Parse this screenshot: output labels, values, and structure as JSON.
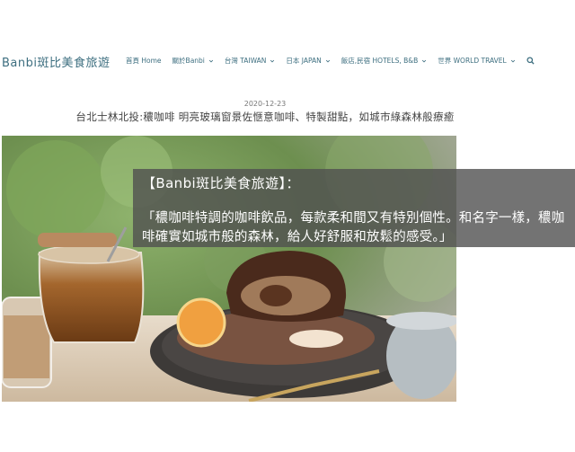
{
  "header": {
    "site_title": "Banbi斑比美食旅遊",
    "nav": [
      {
        "label": "首頁 Home",
        "has_dropdown": false
      },
      {
        "label": "關於Banbi",
        "has_dropdown": true
      },
      {
        "label": "台灣 TAIWAN",
        "has_dropdown": true
      },
      {
        "label": "日本 JAPAN",
        "has_dropdown": true
      },
      {
        "label": "飯店,民宿 HOTELS, B&B",
        "has_dropdown": true
      },
      {
        "label": "世界 WORLD TRAVEL",
        "has_dropdown": true
      }
    ],
    "search_icon": "search-icon"
  },
  "post": {
    "date": "2020-12-23",
    "title": "台北士林北投:穠咖啡 明亮玻璃窗景佐愜意咖啡、特製甜點，如城市綠森林般療癒"
  },
  "hero": {
    "caption_head": "【Banbi斑比美食旅遊】：",
    "caption_body": "「穠咖啡特調的咖啡飲品，每款柔和間又有特別個性。和名字一樣，穠咖啡確實如城市般的森林，給人好舒服和放鬆的感受。」"
  },
  "colors": {
    "accent": "#3e6f80",
    "caption_bg": "#505050"
  }
}
